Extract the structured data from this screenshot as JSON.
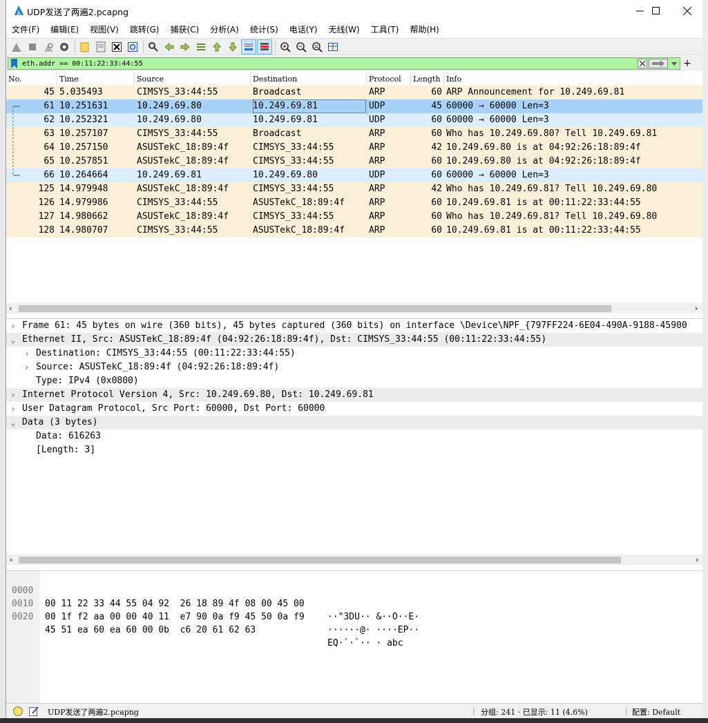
{
  "window": {
    "title": "UDP发送了两遍2.pcapng"
  },
  "menu": [
    "文件(F)",
    "编辑(E)",
    "视图(V)",
    "跳转(G)",
    "捕获(C)",
    "分析(A)",
    "统计(S)",
    "电话(Y)",
    "无线(W)",
    "工具(T)",
    "帮助(H)"
  ],
  "filter": {
    "value": "eth.addr == 00:11:22:33:44:55"
  },
  "packet_list": {
    "headers": {
      "no": "No.",
      "time": "Time",
      "source": "Source",
      "destination": "Destination",
      "protocol": "Protocol",
      "length": "Length",
      "info": "Info"
    },
    "rows": [
      {
        "no": "45",
        "time": "5.035493",
        "source": "CIMSYS_33:44:55",
        "destination": "Broadcast",
        "protocol": "ARP",
        "length": "60",
        "info": "ARP Announcement for 10.249.69.81"
      },
      {
        "no": "61",
        "time": "10.251631",
        "source": "10.249.69.80",
        "destination": "10.249.69.81",
        "protocol": "UDP",
        "length": "45",
        "info": "60000 → 60000 Len=3"
      },
      {
        "no": "62",
        "time": "10.252321",
        "source": "10.249.69.80",
        "destination": "10.249.69.81",
        "protocol": "UDP",
        "length": "60",
        "info": "60000 → 60000 Len=3"
      },
      {
        "no": "63",
        "time": "10.257107",
        "source": "CIMSYS_33:44:55",
        "destination": "Broadcast",
        "protocol": "ARP",
        "length": "60",
        "info": "Who has 10.249.69.80? Tell 10.249.69.81"
      },
      {
        "no": "64",
        "time": "10.257150",
        "source": "ASUSTekC_18:89:4f",
        "destination": "CIMSYS_33:44:55",
        "protocol": "ARP",
        "length": "42",
        "info": "10.249.69.80 is at 04:92:26:18:89:4f"
      },
      {
        "no": "65",
        "time": "10.257851",
        "source": "ASUSTekC_18:89:4f",
        "destination": "CIMSYS_33:44:55",
        "protocol": "ARP",
        "length": "60",
        "info": "10.249.69.80 is at 04:92:26:18:89:4f"
      },
      {
        "no": "66",
        "time": "10.264664",
        "source": "10.249.69.81",
        "destination": "10.249.69.80",
        "protocol": "UDP",
        "length": "60",
        "info": "60000 → 60000 Len=3"
      },
      {
        "no": "125",
        "time": "14.979948",
        "source": "ASUSTekC_18:89:4f",
        "destination": "CIMSYS_33:44:55",
        "protocol": "ARP",
        "length": "42",
        "info": "Who has 10.249.69.81? Tell 10.249.69.80"
      },
      {
        "no": "126",
        "time": "14.979986",
        "source": "CIMSYS_33:44:55",
        "destination": "ASUSTekC_18:89:4f",
        "protocol": "ARP",
        "length": "60",
        "info": "10.249.69.81 is at 00:11:22:33:44:55"
      },
      {
        "no": "127",
        "time": "14.980662",
        "source": "ASUSTekC_18:89:4f",
        "destination": "CIMSYS_33:44:55",
        "protocol": "ARP",
        "length": "60",
        "info": "Who has 10.249.69.81? Tell 10.249.69.80"
      },
      {
        "no": "128",
        "time": "14.980707",
        "source": "CIMSYS_33:44:55",
        "destination": "ASUSTekC_18:89:4f",
        "protocol": "ARP",
        "length": "60",
        "info": "10.249.69.81 is at 00:11:22:33:44:55"
      }
    ]
  },
  "details": [
    "Frame 61: 45 bytes on wire (360 bits), 45 bytes captured (360 bits) on interface \\Device\\NPF_{797FF224-6E04-490A-9188-45900",
    "Ethernet II, Src: ASUSTekC_18:89:4f (04:92:26:18:89:4f), Dst: CIMSYS_33:44:55 (00:11:22:33:44:55)",
    "Destination: CIMSYS_33:44:55 (00:11:22:33:44:55)",
    "Source: ASUSTekC_18:89:4f (04:92:26:18:89:4f)",
    "Type: IPv4 (0x0800)",
    "Internet Protocol Version 4, Src: 10.249.69.80, Dst: 10.249.69.81",
    "User Datagram Protocol, Src Port: 60000, Dst Port: 60000",
    "Data (3 bytes)",
    "Data: 616263",
    "[Length: 3]"
  ],
  "bytes": [
    {
      "offset": "0000",
      "hex": "00 11 22 33 44 55 04 92  26 18 89 4f 08 00 45 00",
      "ascii": "··\"3DU·· &··O··E·"
    },
    {
      "offset": "0010",
      "hex": "00 1f f2 aa 00 00 40 11  e7 90 0a f9 45 50 0a f9",
      "ascii": "······@· ····EP··"
    },
    {
      "offset": "0020",
      "hex": "45 51 ea 60 ea 60 00 0b  c6 20 61 62 63",
      "ascii": "EQ·`·`·· · abc"
    }
  ],
  "status": {
    "file": "UDP发送了两遍2.pcapng",
    "packets": "分组: 241 · 已显示: 11 (4.6%)",
    "profile": "配置: Default"
  },
  "colors": {
    "arp_row": "#faf0d7",
    "udp_row": "#daeeff",
    "selected_row": "#a8d2f7",
    "filter_ok": "#aff5a1"
  }
}
